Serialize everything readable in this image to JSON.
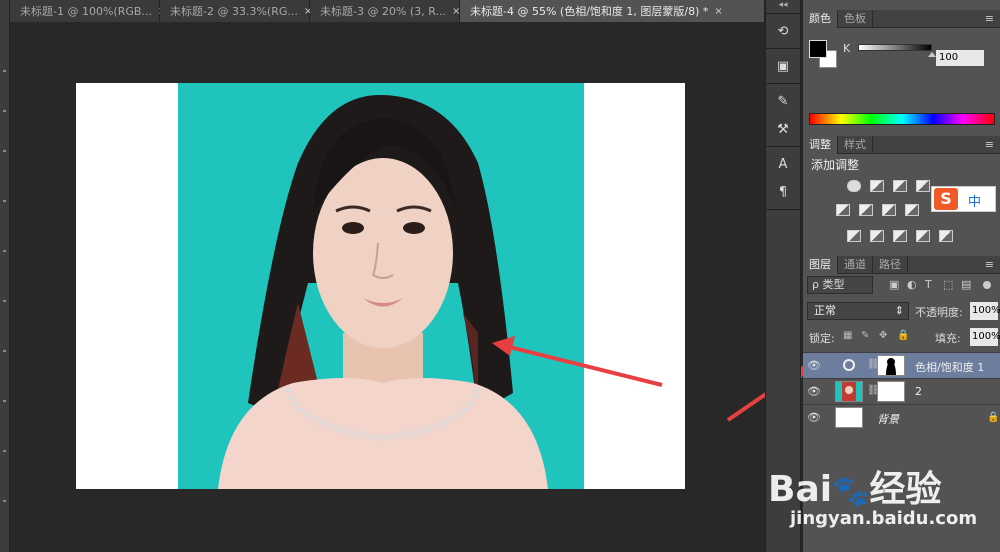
{
  "tabs": [
    {
      "label": "未标题-1 @ 100%(RGB...",
      "active": false
    },
    {
      "label": "未标题-2 @ 33.3%(RG...",
      "active": false
    },
    {
      "label": "未标题-3 @ 20% (3, R...",
      "active": false
    },
    {
      "label": "未标题-4 @ 55% (色相/饱和度 1, 图层蒙版/8) *",
      "active": true
    }
  ],
  "tab_close": "×",
  "icon_column": {
    "collapse": "◂◂",
    "buttons": [
      "history-icon",
      "3d-cube-icon",
      "brush-icon",
      "tool-presets-icon",
      "character-icon",
      "paragraph-icon"
    ],
    "character_glyph": "A",
    "paragraph_glyph": "¶"
  },
  "color_panel": {
    "tabs": [
      "颜色",
      "色板"
    ],
    "channel_label": "K",
    "value": "100",
    "foreground": "#000000",
    "background": "#ffffff"
  },
  "adjustments_panel": {
    "tabs": [
      "调整",
      "样式"
    ],
    "title": "添加调整"
  },
  "ime": {
    "logo": "S",
    "mode": "中"
  },
  "layers_panel": {
    "tabs": [
      "图层",
      "通道",
      "路径"
    ],
    "filter_label": "ρ 类型",
    "blend_mode": "正常",
    "opacity_label": "不透明度:",
    "opacity_value": "100%",
    "lock_label": "锁定:",
    "fill_label": "填充:",
    "fill_value": "100%",
    "layers": [
      {
        "name": "色相/饱和度 1",
        "selected": true
      },
      {
        "name": "2",
        "selected": false
      },
      {
        "name": "背景",
        "selected": false
      }
    ]
  },
  "menu_glyph": "≡",
  "watermark": {
    "brand": "Bai",
    "brand_suffix": "经验",
    "url": "jingyan.baidu.com"
  },
  "colors": {
    "photo_background": "#1fc4bc",
    "arrow": "#e84040",
    "selected_layer": "#6d7d9d"
  }
}
